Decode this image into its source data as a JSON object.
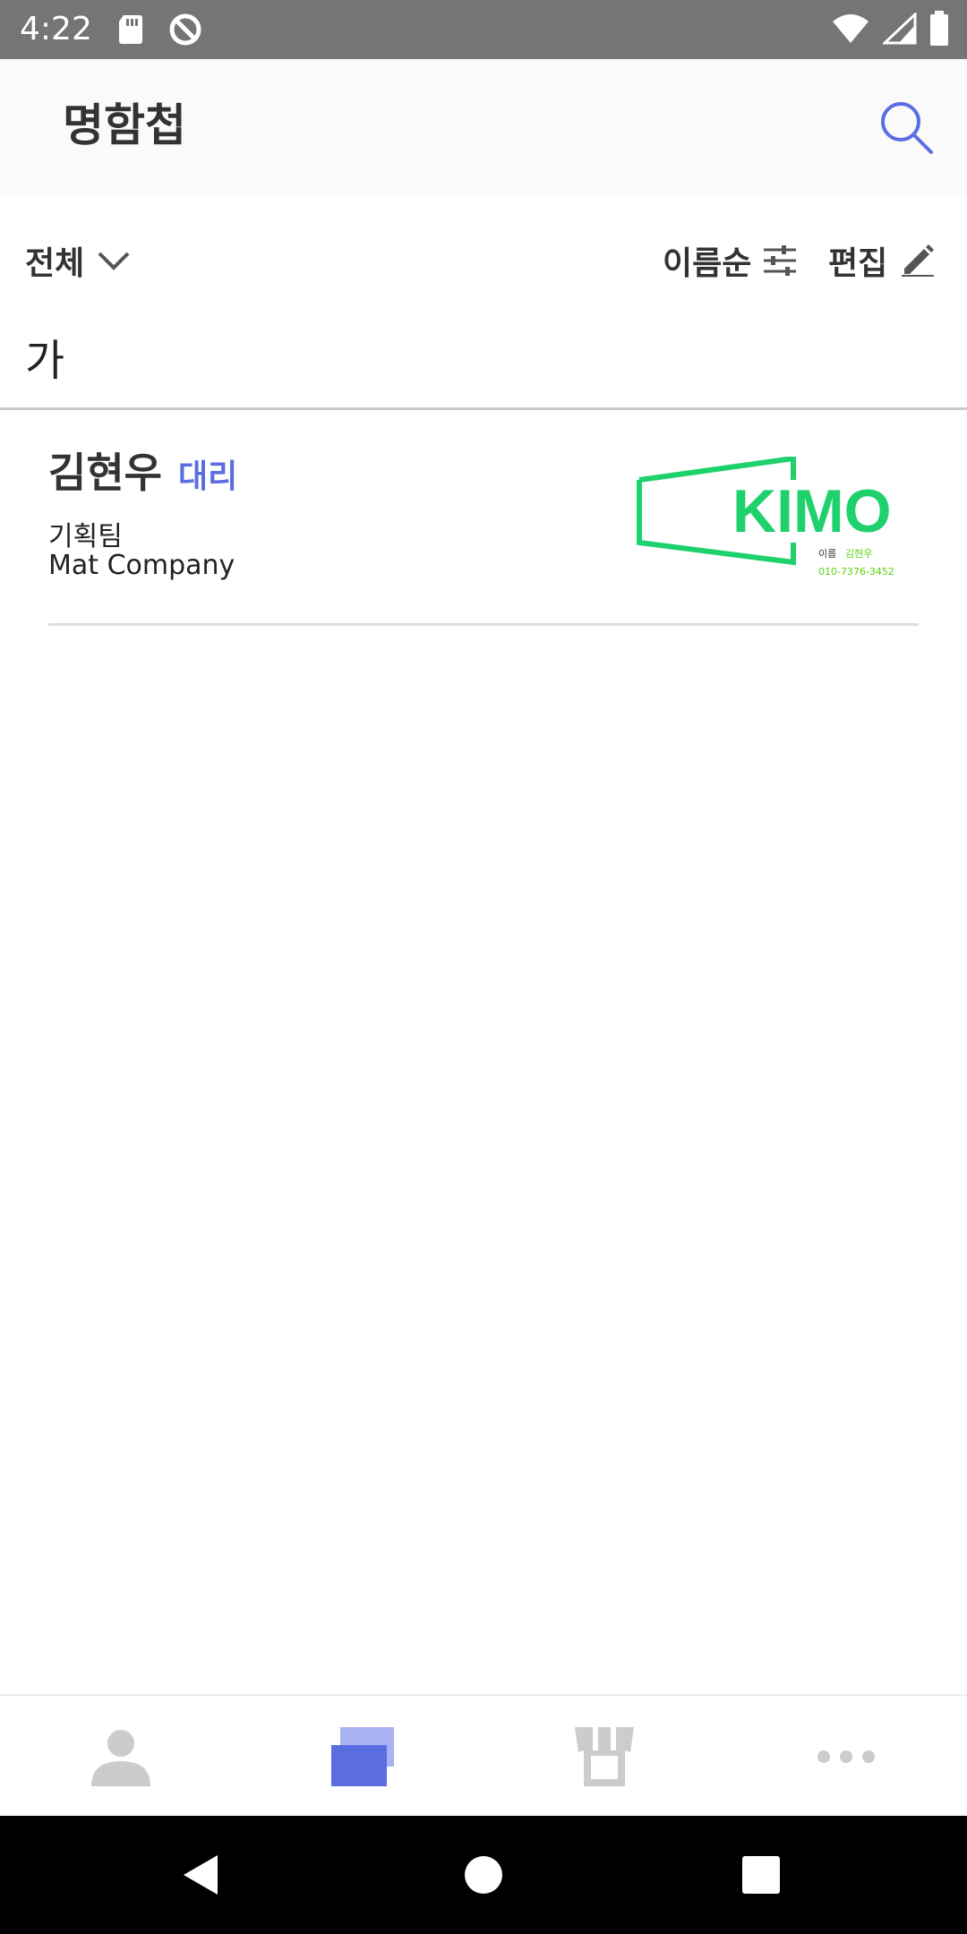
{
  "status_bar": {
    "time": "4:22",
    "icons": [
      "sd-card-icon",
      "sync-disabled-icon",
      "wifi-icon",
      "signal-icon",
      "battery-icon"
    ]
  },
  "app_bar": {
    "title": "명함첩",
    "search_icon": "search-icon"
  },
  "filter_bar": {
    "group_label": "전체",
    "sort_label": "이름순",
    "edit_label": "편집"
  },
  "sections": [
    {
      "header": "가",
      "cards": [
        {
          "name": "김현우",
          "position": "대리",
          "team": "기획팀",
          "company": "Mat Company",
          "thumbnail": {
            "logo_text": "KIMO",
            "name_label": "이름",
            "name_value": "김현우",
            "phone": "010-7376-3452"
          }
        }
      ]
    }
  ],
  "bottom_nav": {
    "items": [
      "profile-icon",
      "cards-icon",
      "store-icon",
      "more-icon"
    ],
    "active_index": 1
  },
  "colors": {
    "accent": "#5b6ee1",
    "kimo_green": "#1fd16d",
    "text_dark": "#333333"
  }
}
